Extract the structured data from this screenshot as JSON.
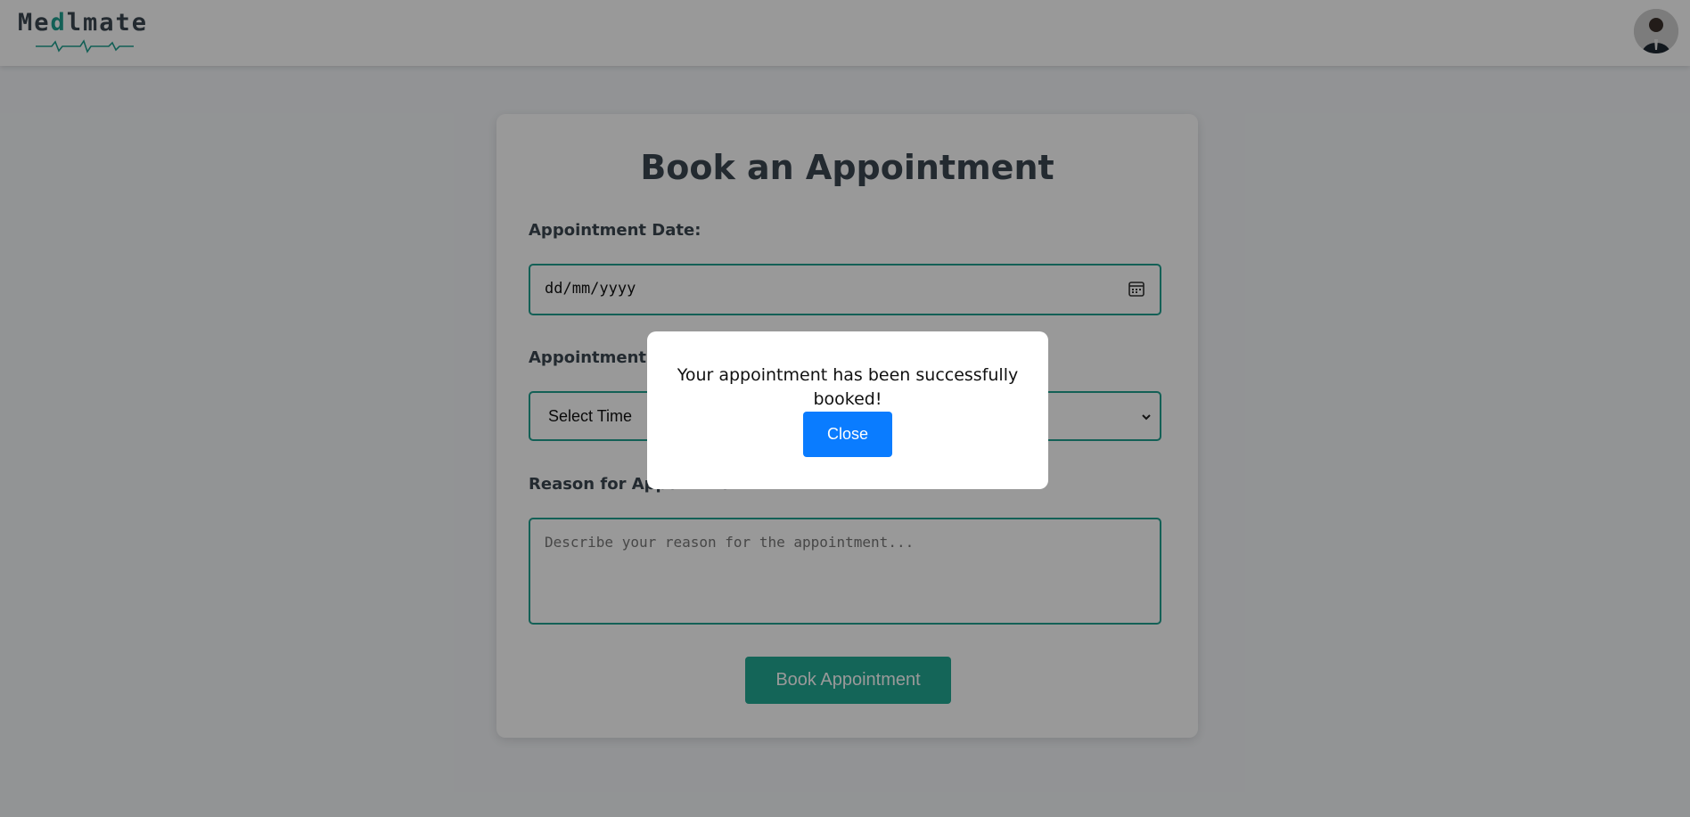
{
  "header": {
    "logo_text_prefix": "Me",
    "logo_text_accent": "d",
    "logo_text_suffix": "lmate"
  },
  "form": {
    "title": "Book an Appointment",
    "date_label": "Appointment Date:",
    "date_value": "dd/mm/yyyy",
    "time_label": "Appointment Time:",
    "time_selected": "Select Time",
    "reason_label": "Reason for Appointment:",
    "reason_placeholder": "Describe your reason for the appointment...",
    "submit_label": "Book Appointment"
  },
  "modal": {
    "message": "Your appointment has been successfully booked!",
    "close_label": "Close"
  },
  "colors": {
    "accent": "#20a090",
    "primary_button": "#0a7cff",
    "heading": "#3b4651"
  },
  "icons": {
    "date_icon": "calendar-icon",
    "select_icon": "chevron-down-icon",
    "avatar": "user-avatar"
  }
}
